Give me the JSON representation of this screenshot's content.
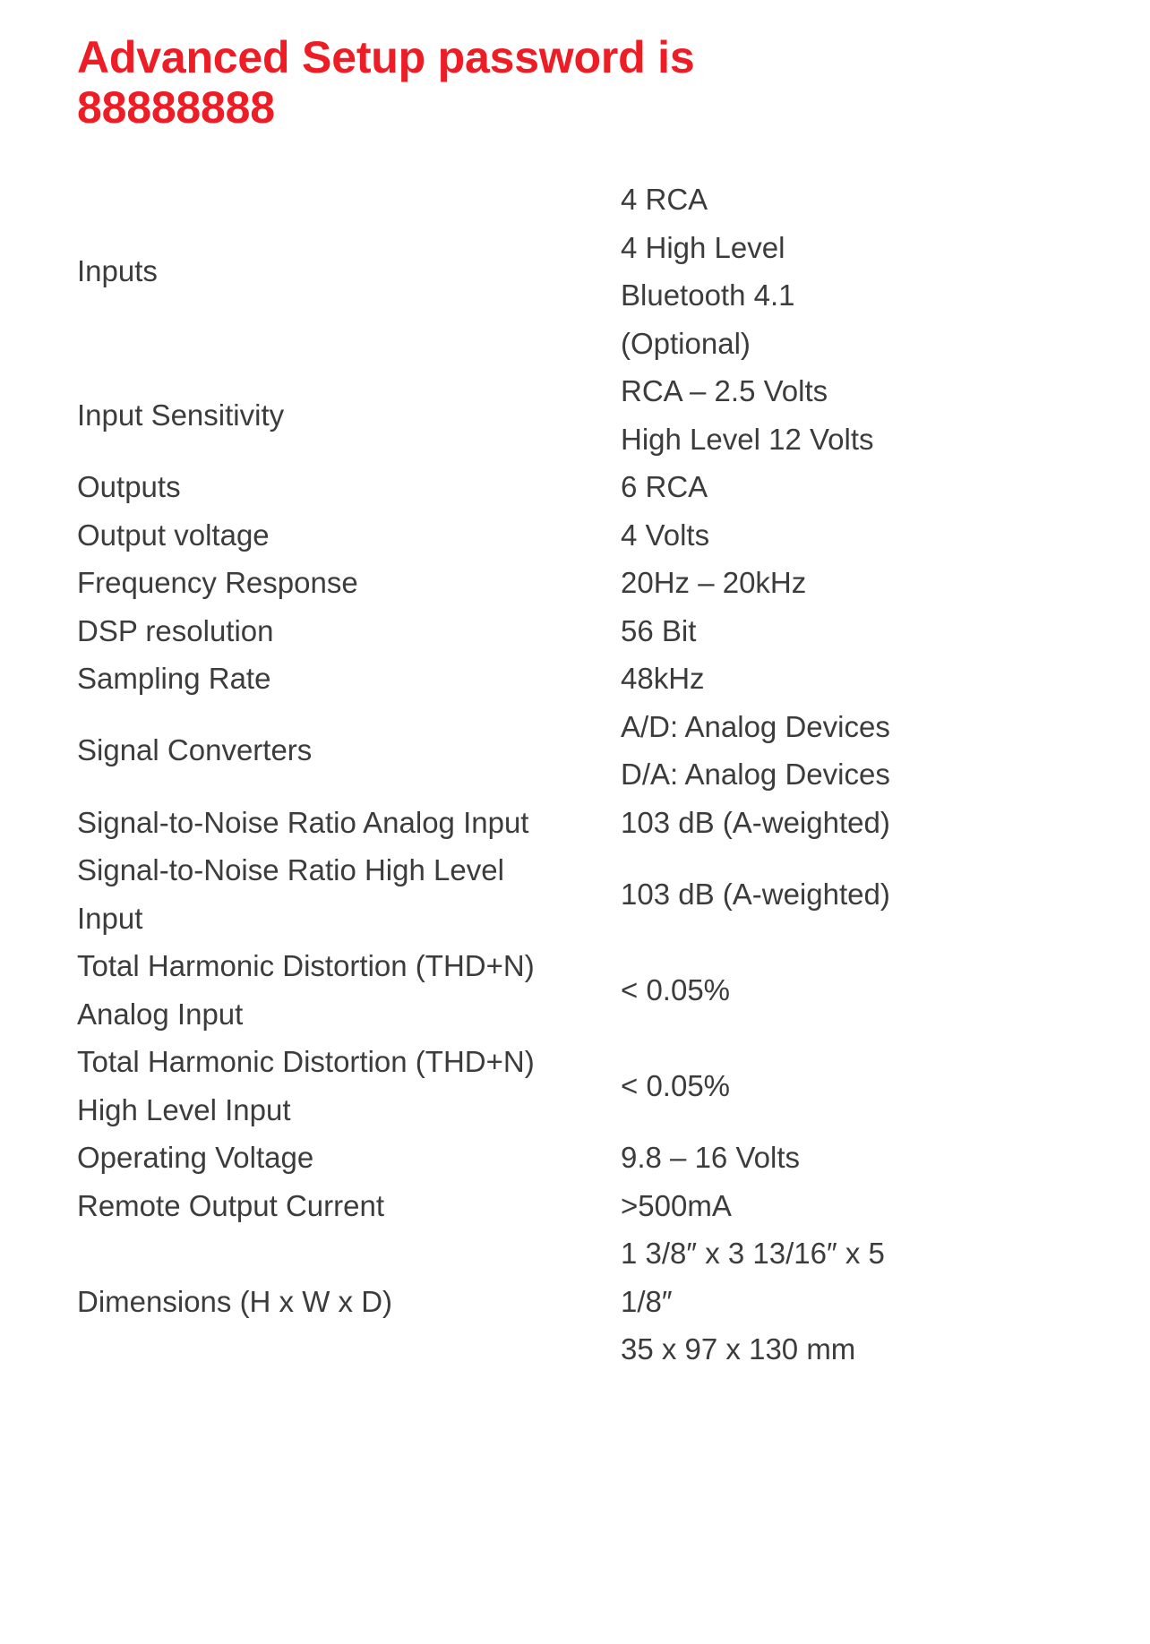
{
  "headline": "Advanced Setup password is 88888888",
  "accent_color": "#ee1c24",
  "text_color": "#3c3c3c",
  "background_color": "#ffffff",
  "spec_table": {
    "rows": [
      {
        "label": "Inputs",
        "label_lines": [
          "Inputs"
        ],
        "value": "4 RCA 4 High Level Bluetooth 4.1 (Optional)",
        "value_lines": [
          "4 RCA",
          "4 High Level",
          "Bluetooth 4.1",
          "(Optional)"
        ]
      },
      {
        "label": "Input Sensitivity",
        "label_lines": [
          "Input Sensitivity"
        ],
        "value": "RCA – 2.5 Volts High Level 12 Volts",
        "value_lines": [
          "RCA – 2.5 Volts",
          "High Level 12 Volts"
        ]
      },
      {
        "label": "Outputs",
        "label_lines": [
          "Outputs"
        ],
        "value": "6 RCA",
        "value_lines": [
          "6 RCA"
        ]
      },
      {
        "label": "Output voltage",
        "label_lines": [
          "Output voltage"
        ],
        "value": "4 Volts",
        "value_lines": [
          "4 Volts"
        ]
      },
      {
        "label": "Frequency Response",
        "label_lines": [
          "Frequency Response"
        ],
        "value": "20Hz – 20kHz",
        "value_lines": [
          "20Hz – 20kHz"
        ]
      },
      {
        "label": "DSP resolution",
        "label_lines": [
          "DSP resolution"
        ],
        "value": "56 Bit",
        "value_lines": [
          "56 Bit"
        ]
      },
      {
        "label": "Sampling Rate",
        "label_lines": [
          "Sampling Rate"
        ],
        "value": "48kHz",
        "value_lines": [
          "48kHz"
        ]
      },
      {
        "label": "Signal Converters",
        "label_lines": [
          "Signal Converters"
        ],
        "value": "A/D: Analog Devices D/A: Analog Devices",
        "value_lines": [
          "A/D: Analog Devices",
          "D/A: Analog Devices"
        ]
      },
      {
        "label": "Signal-to-Noise Ratio Analog Input",
        "label_lines": [
          "Signal-to-Noise Ratio Analog Input"
        ],
        "value": "103 dB (A-weighted)",
        "value_lines": [
          "103 dB (A-weighted)"
        ]
      },
      {
        "label": "Signal-to-Noise Ratio High Level Input",
        "label_lines": [
          "Signal-to-Noise Ratio High Level",
          "Input"
        ],
        "value": "103 dB (A-weighted)",
        "value_lines": [
          "103 dB (A-weighted)"
        ]
      },
      {
        "label": "Total Harmonic Distortion (THD+N) Analog Input",
        "label_lines": [
          "Total Harmonic Distortion (THD+N)",
          "Analog Input"
        ],
        "value": "< 0.05%",
        "value_lines": [
          "< 0.05%"
        ]
      },
      {
        "label": "Total Harmonic Distortion (THD+N) High Level Input",
        "label_lines": [
          "Total Harmonic Distortion (THD+N)",
          "High Level Input"
        ],
        "value": "< 0.05%",
        "value_lines": [
          "< 0.05%"
        ]
      },
      {
        "label": "Operating Voltage",
        "label_lines": [
          "Operating Voltage"
        ],
        "value": "9.8 – 16 Volts",
        "value_lines": [
          "9.8 – 16 Volts"
        ]
      },
      {
        "label": "Remote Output Current",
        "label_lines": [
          "Remote Output Current"
        ],
        "value": ">500mA",
        "value_lines": [
          ">500mA"
        ]
      },
      {
        "label": "Dimensions (H x W x D)",
        "label_lines": [
          "Dimensions (H x W x D)"
        ],
        "value": "1 3/8″ x 3 13/16″ x 5 1/8″ 35 x 97 x 130 mm",
        "value_lines": [
          "1 3/8″ x 3 13/16″ x 5",
          "1/8″",
          "35 x 97 x 130 mm"
        ]
      }
    ]
  }
}
